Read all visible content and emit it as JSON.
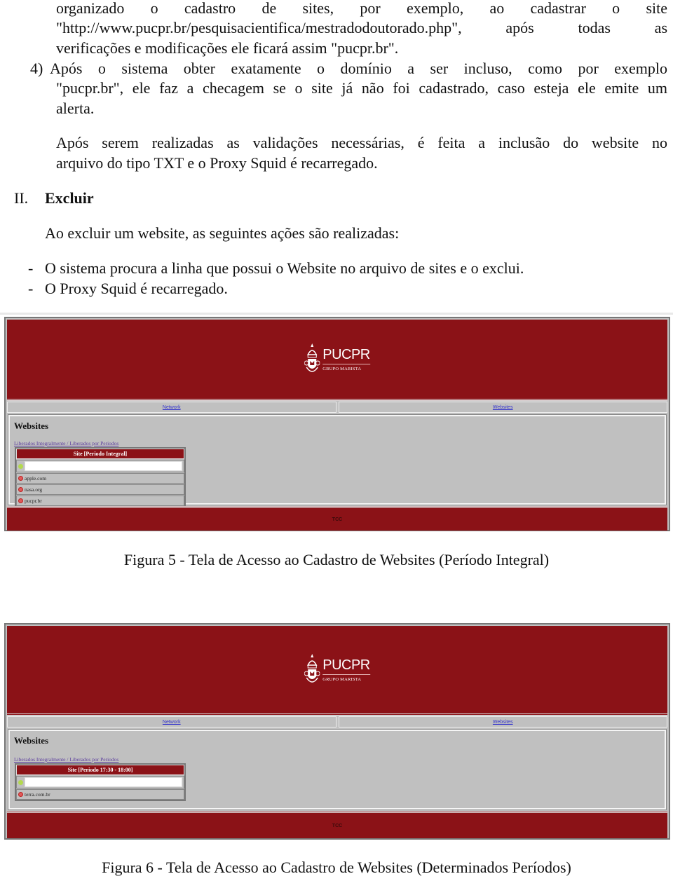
{
  "body": {
    "para1": [
      "organizado o cadastro de sites, por exemplo, ao cadastrar o site",
      "\"http://www.pucpr.br/pesquisacientifica/mestradodoutorado.php\", após todas as",
      "verificações e modificações ele ficará assim \"pucpr.br\"."
    ],
    "item4_number": "4)",
    "item4": [
      "Após o sistema obter exatamente o domínio a ser incluso, como por exemplo",
      "\"pucpr.br\", ele faz a checagem se o site já não foi cadastrado, caso esteja ele emite um",
      "alerta."
    ],
    "para2": [
      "Após serem realizadas as validações necessárias, é feita a inclusão do website no",
      "arquivo do tipo TXT e o Proxy Squid é recarregado."
    ],
    "section_number": "II.",
    "section_title": "Excluir",
    "para3": "Ao excluir um website, as seguintes ações são realizadas:",
    "bullets": [
      "O sistema procura a linha que possui o Website no arquivo de sites e o exclui.",
      "O Proxy Squid é recarregado."
    ],
    "bullet_marker": "-"
  },
  "figures": [
    {
      "logo_name": "PUCPR",
      "logo_sub": "GRUPO MARISTA",
      "nav": [
        "Network",
        "Websites"
      ],
      "heading": "Websites",
      "filter_link": "Liberados Integralmente / Liberados por Periodos",
      "table_header": "Site [Periodo Integral]",
      "add_input_value": "",
      "sites": [
        "apple.com",
        "nasa.org",
        "pucpr.br"
      ],
      "footer": "TCC",
      "caption": "Figura 5 - Tela de Acesso ao Cadastro de Websites (Período Integral)"
    },
    {
      "logo_name": "PUCPR",
      "logo_sub": "GRUPO MARISTA",
      "nav": [
        "Network",
        "Websites"
      ],
      "heading": "Websites",
      "filter_link": "Liberados Integralmente / Liberados por Periodos",
      "table_header": "Site [Periodo 17:30 - 18:00]",
      "add_input_value": "",
      "sites": [
        "terra.com.br"
      ],
      "footer": "TCC",
      "caption": "Figura 6 - Tela de Acesso ao Cadastro de Websites (Determinados Períodos)"
    }
  ],
  "colors": {
    "brand": "#8b1217",
    "panel": "#c0c0c0",
    "link": "#3333cc"
  }
}
